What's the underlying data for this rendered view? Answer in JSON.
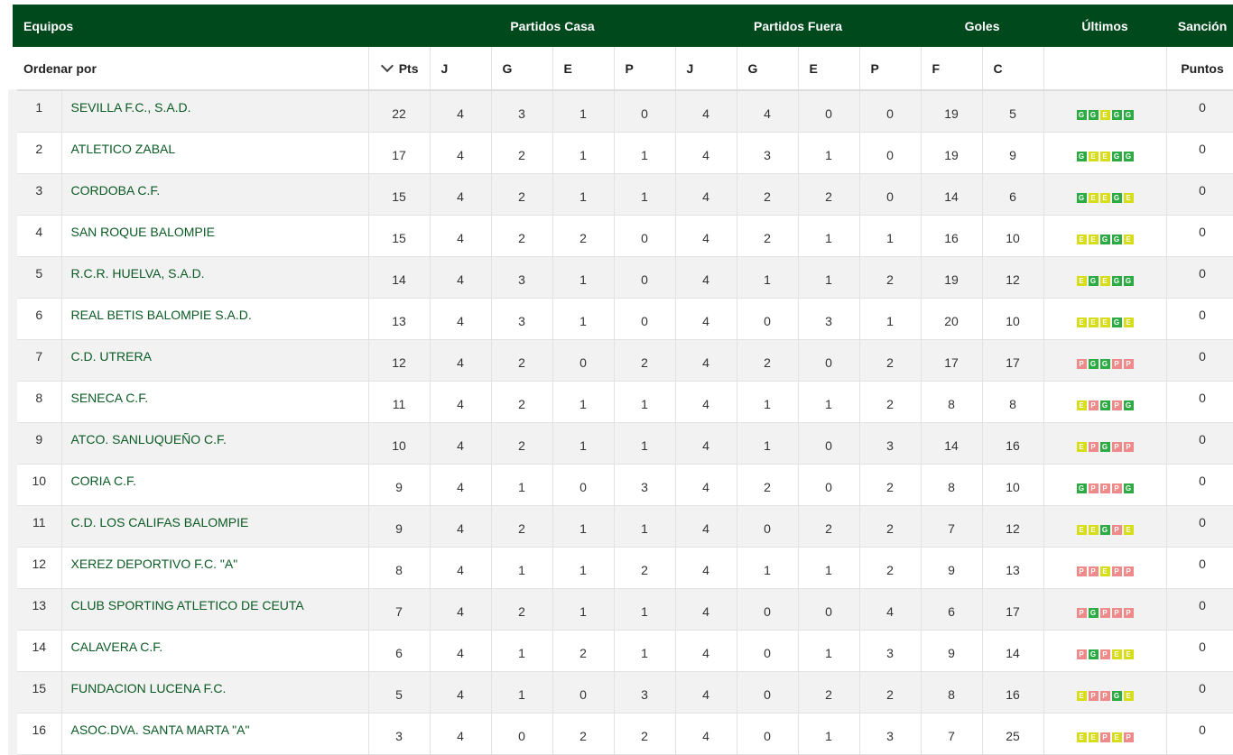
{
  "header": {
    "equipos": "Equipos",
    "partidos_casa": "Partidos Casa",
    "partidos_fuera": "Partidos Fuera",
    "goles": "Goles",
    "ultimos": "Últimos",
    "sancion": "Sanción"
  },
  "subheader": {
    "ordenar_por": "Ordenar por",
    "pts": "Pts",
    "j1": "J",
    "g1": "G",
    "e1": "E",
    "p1": "P",
    "j2": "J",
    "g2": "G",
    "e2": "E",
    "p2": "P",
    "f": "F",
    "c": "C",
    "puntos": "Puntos"
  },
  "colors": {
    "header_bg": "#00491d",
    "win": "#2eaa45",
    "draw": "#d7dc1b",
    "loss": "#ef8a8a",
    "team_text": "#0a5a24"
  },
  "rows": [
    {
      "pos": "1",
      "team": "SEVILLA F.C., S.A.D.",
      "pts": "22",
      "hj": "4",
      "hg": "3",
      "he": "1",
      "hp": "0",
      "aj": "4",
      "ag": "4",
      "ae": "0",
      "ap": "0",
      "f": "19",
      "c": "5",
      "last": [
        "G",
        "G",
        "E",
        "G",
        "G"
      ],
      "san": "0"
    },
    {
      "pos": "2",
      "team": "ATLETICO ZABAL",
      "pts": "17",
      "hj": "4",
      "hg": "2",
      "he": "1",
      "hp": "1",
      "aj": "4",
      "ag": "3",
      "ae": "1",
      "ap": "0",
      "f": "19",
      "c": "9",
      "last": [
        "G",
        "E",
        "E",
        "G",
        "G"
      ],
      "san": "0"
    },
    {
      "pos": "3",
      "team": "CORDOBA C.F.",
      "pts": "15",
      "hj": "4",
      "hg": "2",
      "he": "1",
      "hp": "1",
      "aj": "4",
      "ag": "2",
      "ae": "2",
      "ap": "0",
      "f": "14",
      "c": "6",
      "last": [
        "G",
        "E",
        "E",
        "G",
        "E"
      ],
      "san": "0"
    },
    {
      "pos": "4",
      "team": "SAN ROQUE BALOMPIE",
      "pts": "15",
      "hj": "4",
      "hg": "2",
      "he": "2",
      "hp": "0",
      "aj": "4",
      "ag": "2",
      "ae": "1",
      "ap": "1",
      "f": "16",
      "c": "10",
      "last": [
        "E",
        "E",
        "G",
        "G",
        "E"
      ],
      "san": "0"
    },
    {
      "pos": "5",
      "team": "R.C.R. HUELVA, S.A.D.",
      "pts": "14",
      "hj": "4",
      "hg": "3",
      "he": "1",
      "hp": "0",
      "aj": "4",
      "ag": "1",
      "ae": "1",
      "ap": "2",
      "f": "19",
      "c": "12",
      "last": [
        "E",
        "G",
        "E",
        "G",
        "G"
      ],
      "san": "0"
    },
    {
      "pos": "6",
      "team": "REAL BETIS BALOMPIE S.A.D.",
      "pts": "13",
      "hj": "4",
      "hg": "3",
      "he": "1",
      "hp": "0",
      "aj": "4",
      "ag": "0",
      "ae": "3",
      "ap": "1",
      "f": "20",
      "c": "10",
      "last": [
        "E",
        "E",
        "E",
        "G",
        "E"
      ],
      "san": "0"
    },
    {
      "pos": "7",
      "team": "C.D. UTRERA",
      "pts": "12",
      "hj": "4",
      "hg": "2",
      "he": "0",
      "hp": "2",
      "aj": "4",
      "ag": "2",
      "ae": "0",
      "ap": "2",
      "f": "17",
      "c": "17",
      "last": [
        "P",
        "G",
        "G",
        "P",
        "P"
      ],
      "san": "0"
    },
    {
      "pos": "8",
      "team": "SENECA C.F.",
      "pts": "11",
      "hj": "4",
      "hg": "2",
      "he": "1",
      "hp": "1",
      "aj": "4",
      "ag": "1",
      "ae": "1",
      "ap": "2",
      "f": "8",
      "c": "8",
      "last": [
        "E",
        "P",
        "G",
        "P",
        "G"
      ],
      "san": "0"
    },
    {
      "pos": "9",
      "team": "ATCO. SANLUQUEÑO C.F.",
      "pts": "10",
      "hj": "4",
      "hg": "2",
      "he": "1",
      "hp": "1",
      "aj": "4",
      "ag": "1",
      "ae": "0",
      "ap": "3",
      "f": "14",
      "c": "16",
      "last": [
        "E",
        "P",
        "G",
        "P",
        "P"
      ],
      "san": "0"
    },
    {
      "pos": "10",
      "team": "CORIA C.F.",
      "pts": "9",
      "hj": "4",
      "hg": "1",
      "he": "0",
      "hp": "3",
      "aj": "4",
      "ag": "2",
      "ae": "0",
      "ap": "2",
      "f": "8",
      "c": "10",
      "last": [
        "G",
        "P",
        "P",
        "P",
        "G"
      ],
      "san": "0"
    },
    {
      "pos": "11",
      "team": "C.D. LOS CALIFAS BALOMPIE",
      "pts": "9",
      "hj": "4",
      "hg": "2",
      "he": "1",
      "hp": "1",
      "aj": "4",
      "ag": "0",
      "ae": "2",
      "ap": "2",
      "f": "7",
      "c": "12",
      "last": [
        "E",
        "E",
        "G",
        "P",
        "E"
      ],
      "san": "0"
    },
    {
      "pos": "12",
      "team": "XEREZ DEPORTIVO F.C. \"A\"",
      "pts": "8",
      "hj": "4",
      "hg": "1",
      "he": "1",
      "hp": "2",
      "aj": "4",
      "ag": "1",
      "ae": "1",
      "ap": "2",
      "f": "9",
      "c": "13",
      "last": [
        "P",
        "P",
        "E",
        "P",
        "P"
      ],
      "san": "0"
    },
    {
      "pos": "13",
      "team": "CLUB SPORTING ATLETICO DE CEUTA",
      "pts": "7",
      "hj": "4",
      "hg": "2",
      "he": "1",
      "hp": "1",
      "aj": "4",
      "ag": "0",
      "ae": "0",
      "ap": "4",
      "f": "6",
      "c": "17",
      "last": [
        "P",
        "G",
        "P",
        "P",
        "P"
      ],
      "san": "0"
    },
    {
      "pos": "14",
      "team": "CALAVERA C.F.",
      "pts": "6",
      "hj": "4",
      "hg": "1",
      "he": "2",
      "hp": "1",
      "aj": "4",
      "ag": "0",
      "ae": "1",
      "ap": "3",
      "f": "9",
      "c": "14",
      "last": [
        "P",
        "G",
        "P",
        "E",
        "E"
      ],
      "san": "0"
    },
    {
      "pos": "15",
      "team": "FUNDACION LUCENA F.C.",
      "pts": "5",
      "hj": "4",
      "hg": "1",
      "he": "0",
      "hp": "3",
      "aj": "4",
      "ag": "0",
      "ae": "2",
      "ap": "2",
      "f": "8",
      "c": "16",
      "last": [
        "E",
        "P",
        "P",
        "G",
        "E"
      ],
      "san": "0"
    },
    {
      "pos": "16",
      "team": "ASOC.DVA. SANTA MARTA \"A\"",
      "pts": "3",
      "hj": "4",
      "hg": "0",
      "he": "2",
      "hp": "2",
      "aj": "4",
      "ag": "0",
      "ae": "1",
      "ap": "3",
      "f": "7",
      "c": "25",
      "last": [
        "E",
        "E",
        "P",
        "E",
        "P"
      ],
      "san": "0"
    }
  ]
}
